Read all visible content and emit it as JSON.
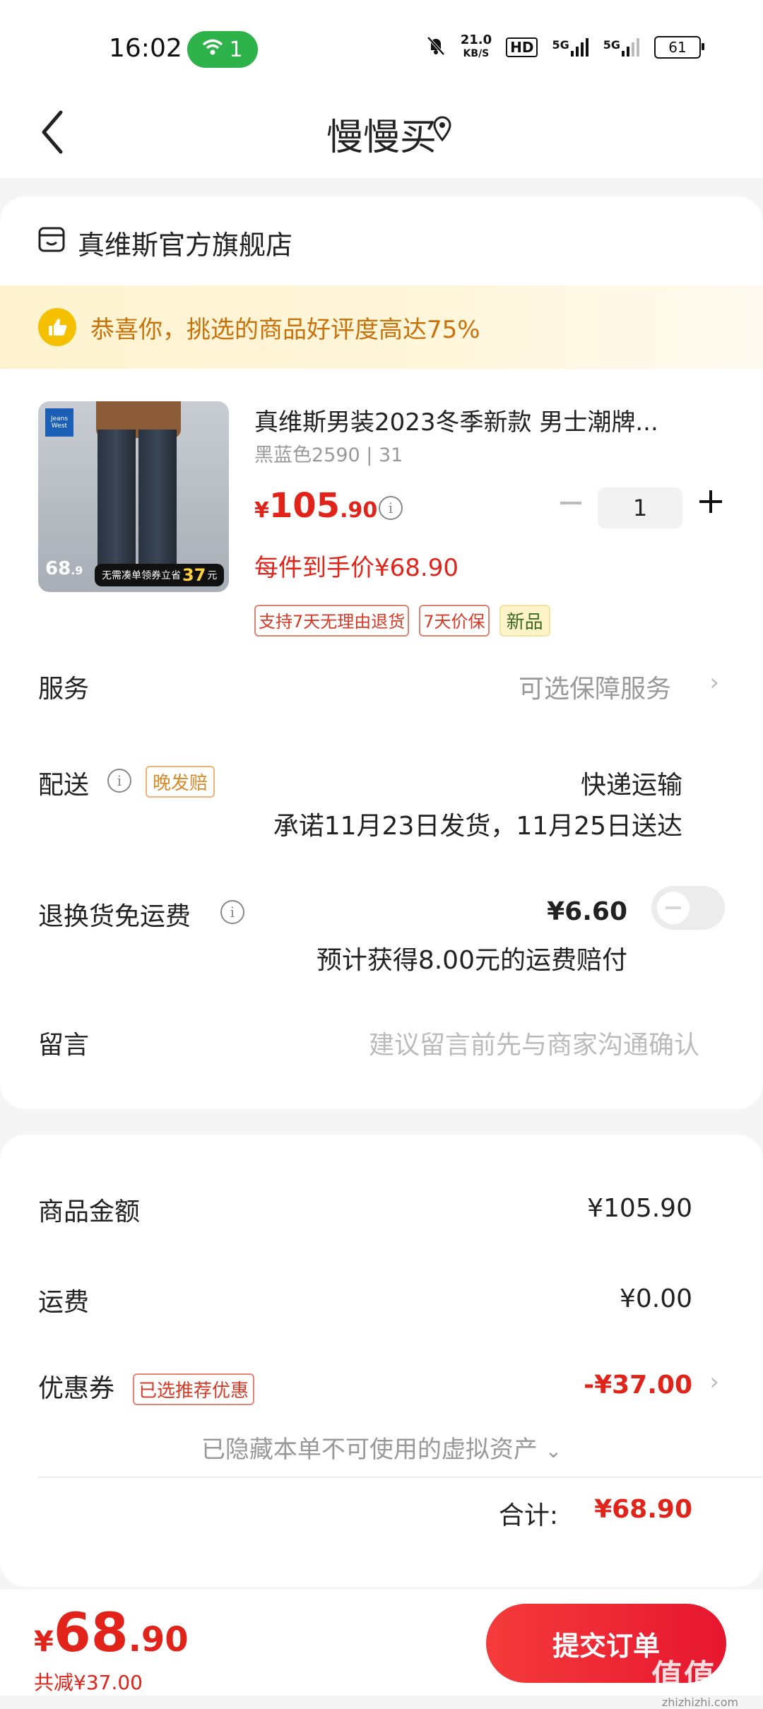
{
  "status_bar": {
    "time": "16:02",
    "wifi_count": "1",
    "net_speed_value": "21.0",
    "net_speed_unit": "KB/S",
    "hd": "HD",
    "net1": "5G",
    "net2": "5G",
    "battery": "61"
  },
  "header": {
    "title": "慢慢买"
  },
  "store": {
    "name": "真维斯官方旗舰店"
  },
  "praise": {
    "text": "恭喜你，挑选的商品好评度高达75%"
  },
  "product": {
    "title": "真维斯男装2023冬季新款 男士潮牌...",
    "spec": "黑蓝色2590 | 31",
    "price_symbol": "¥",
    "price_int": "105",
    "price_dec": ".90",
    "per_item_price": "每件到手价¥68.90",
    "quantity": "1",
    "tags": [
      "支持7天无理由退货",
      "7天价保"
    ],
    "tag_new": "新品",
    "image": {
      "brand": "Jeans West",
      "price_int": "68",
      "price_dec": ".9",
      "banner_text": "无需凑单领券立省",
      "banner_amount": "37",
      "banner_unit": "元"
    }
  },
  "rows": {
    "service_label": "服务",
    "service_value": "可选保障服务",
    "delivery_label": "配送",
    "delivery_badge": "晚发赔",
    "delivery_method": "快递运输",
    "delivery_promise": "承诺11月23日发货，11月25日送达",
    "return_label": "退换货免运费",
    "return_price": "¥6.60",
    "return_note": "预计获得8.00元的运费赔付",
    "message_label": "留言",
    "message_placeholder": "建议留言前先与商家沟通确认"
  },
  "summary": {
    "goods_label": "商品金额",
    "goods_value": "¥105.90",
    "shipping_label": "运费",
    "shipping_value": "¥0.00",
    "coupon_label": "优惠券",
    "coupon_badge": "已选推荐优惠",
    "coupon_value": "-¥37.00",
    "hidden_assets": "已隐藏本单不可使用的虚拟资产",
    "total_label": "合计:",
    "total_value": "¥68.90"
  },
  "bottom": {
    "price_symbol": "¥",
    "price_int": "68",
    "price_dec": ".90",
    "saved": "共减¥37.00",
    "submit": "提交订单"
  },
  "watermark": {
    "main": "值值值",
    "sub": "zhizhizhi.com"
  },
  "colors": {
    "accent_red": "#e2231a",
    "praise_orange": "#c8720c",
    "wifi_green": "#2db34a"
  }
}
